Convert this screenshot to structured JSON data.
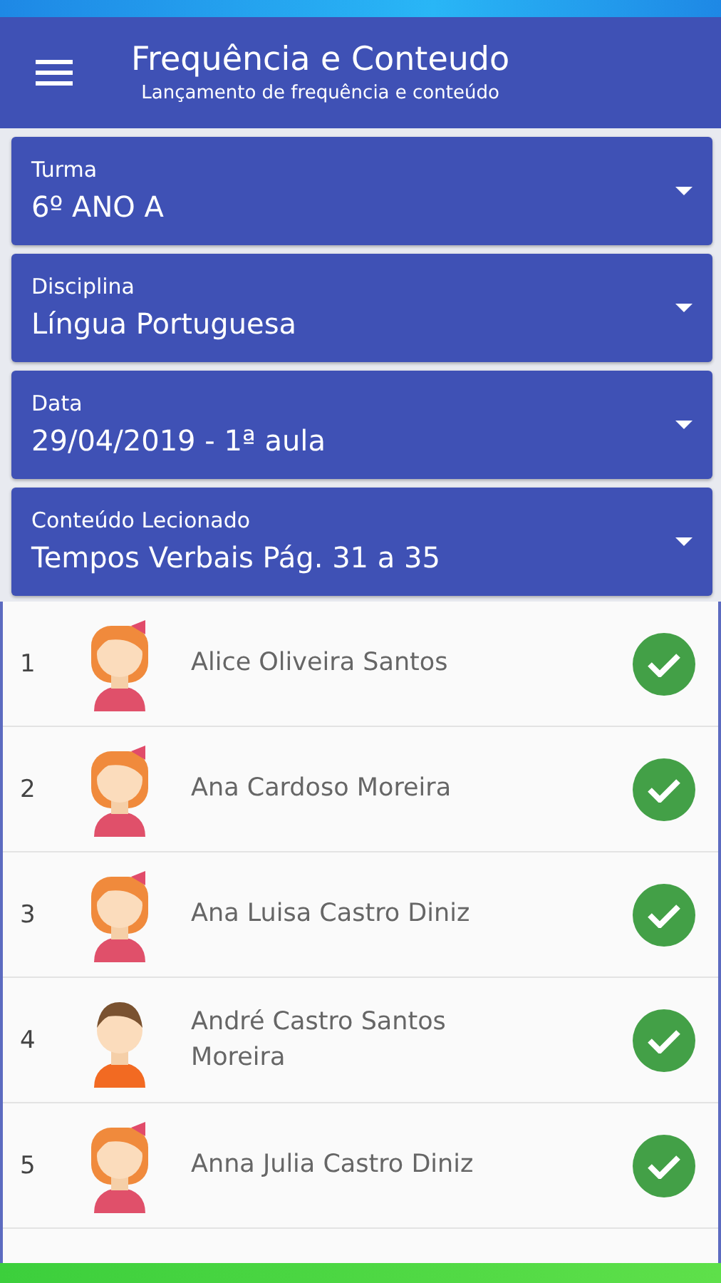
{
  "header": {
    "title": "Frequência e Conteudo",
    "subtitle": "Lançamento de frequência e conteúdo"
  },
  "filters": [
    {
      "label": "Turma",
      "value": "6º ANO A"
    },
    {
      "label": "Disciplina",
      "value": "Língua Portuguesa"
    },
    {
      "label": "Data",
      "value": "29/04/2019 - 1ª aula"
    },
    {
      "label": "Conteúdo Lecionado",
      "value": "Tempos Verbais Pág. 31 a 35"
    }
  ],
  "students": [
    {
      "number": "1",
      "name": "Alice  Oliveira Santos",
      "kind": "girl",
      "present": true
    },
    {
      "number": "2",
      "name": "Ana Cardoso Moreira",
      "kind": "girl",
      "present": true
    },
    {
      "number": "3",
      "name": "Ana Luisa Castro Diniz",
      "kind": "girl",
      "present": true
    },
    {
      "number": "4",
      "name": "André Castro Santos Moreira",
      "kind": "boy",
      "present": true
    },
    {
      "number": "5",
      "name": "Anna Julia Castro Diniz",
      "kind": "girl",
      "present": true
    }
  ]
}
